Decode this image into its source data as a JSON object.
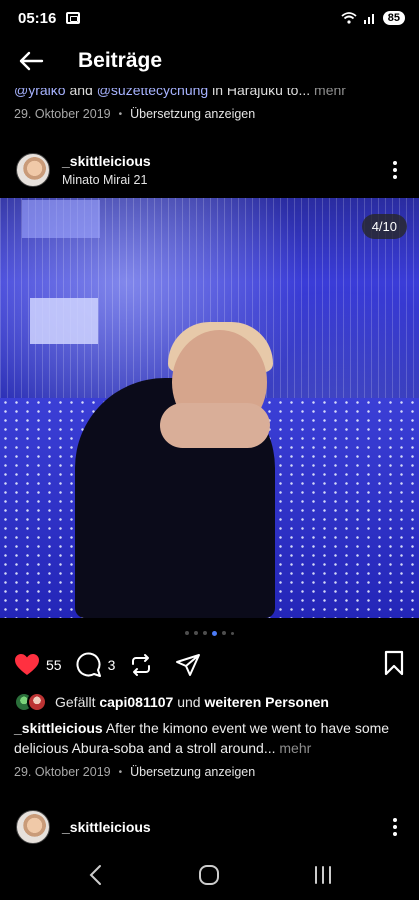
{
  "status": {
    "time": "05:16",
    "battery": "85"
  },
  "header": {
    "title": "Beiträge"
  },
  "previous_post": {
    "caption_mention_1": "@yraiko",
    "caption_and": " and ",
    "caption_mention_2": "@suzettecychung",
    "caption_rest": " in Harajuku to...",
    "caption_more": " mehr",
    "date": "29. Oktober 2019",
    "translate": "Übersetzung anzeigen"
  },
  "post": {
    "username": "_skittleicious",
    "location": "Minato Mirai 21",
    "media_counter": "4/10",
    "carousel_active_index": 4,
    "likes_count": "55",
    "comments_count": "3",
    "likes_prefix": "Gefällt ",
    "likes_user": "capi081107",
    "likes_middle": " und ",
    "likes_suffix": "weiteren Personen",
    "caption_user": "_skittleicious",
    "caption_text": " After the kimono event we went to have some delicious Abura-soba and a stroll around...",
    "caption_more": " mehr",
    "date": "29. Oktober 2019",
    "translate": "Übersetzung anzeigen"
  },
  "next_post": {
    "username": "_skittleicious"
  },
  "colors": {
    "like_red": "#ff3040",
    "accent_blue": "#4c7bf6",
    "mention": "#a7b3ff"
  },
  "icons": [
    "back-arrow-icon",
    "heart-icon",
    "comment-icon",
    "repost-icon",
    "share-icon",
    "bookmark-icon",
    "more-icon"
  ]
}
